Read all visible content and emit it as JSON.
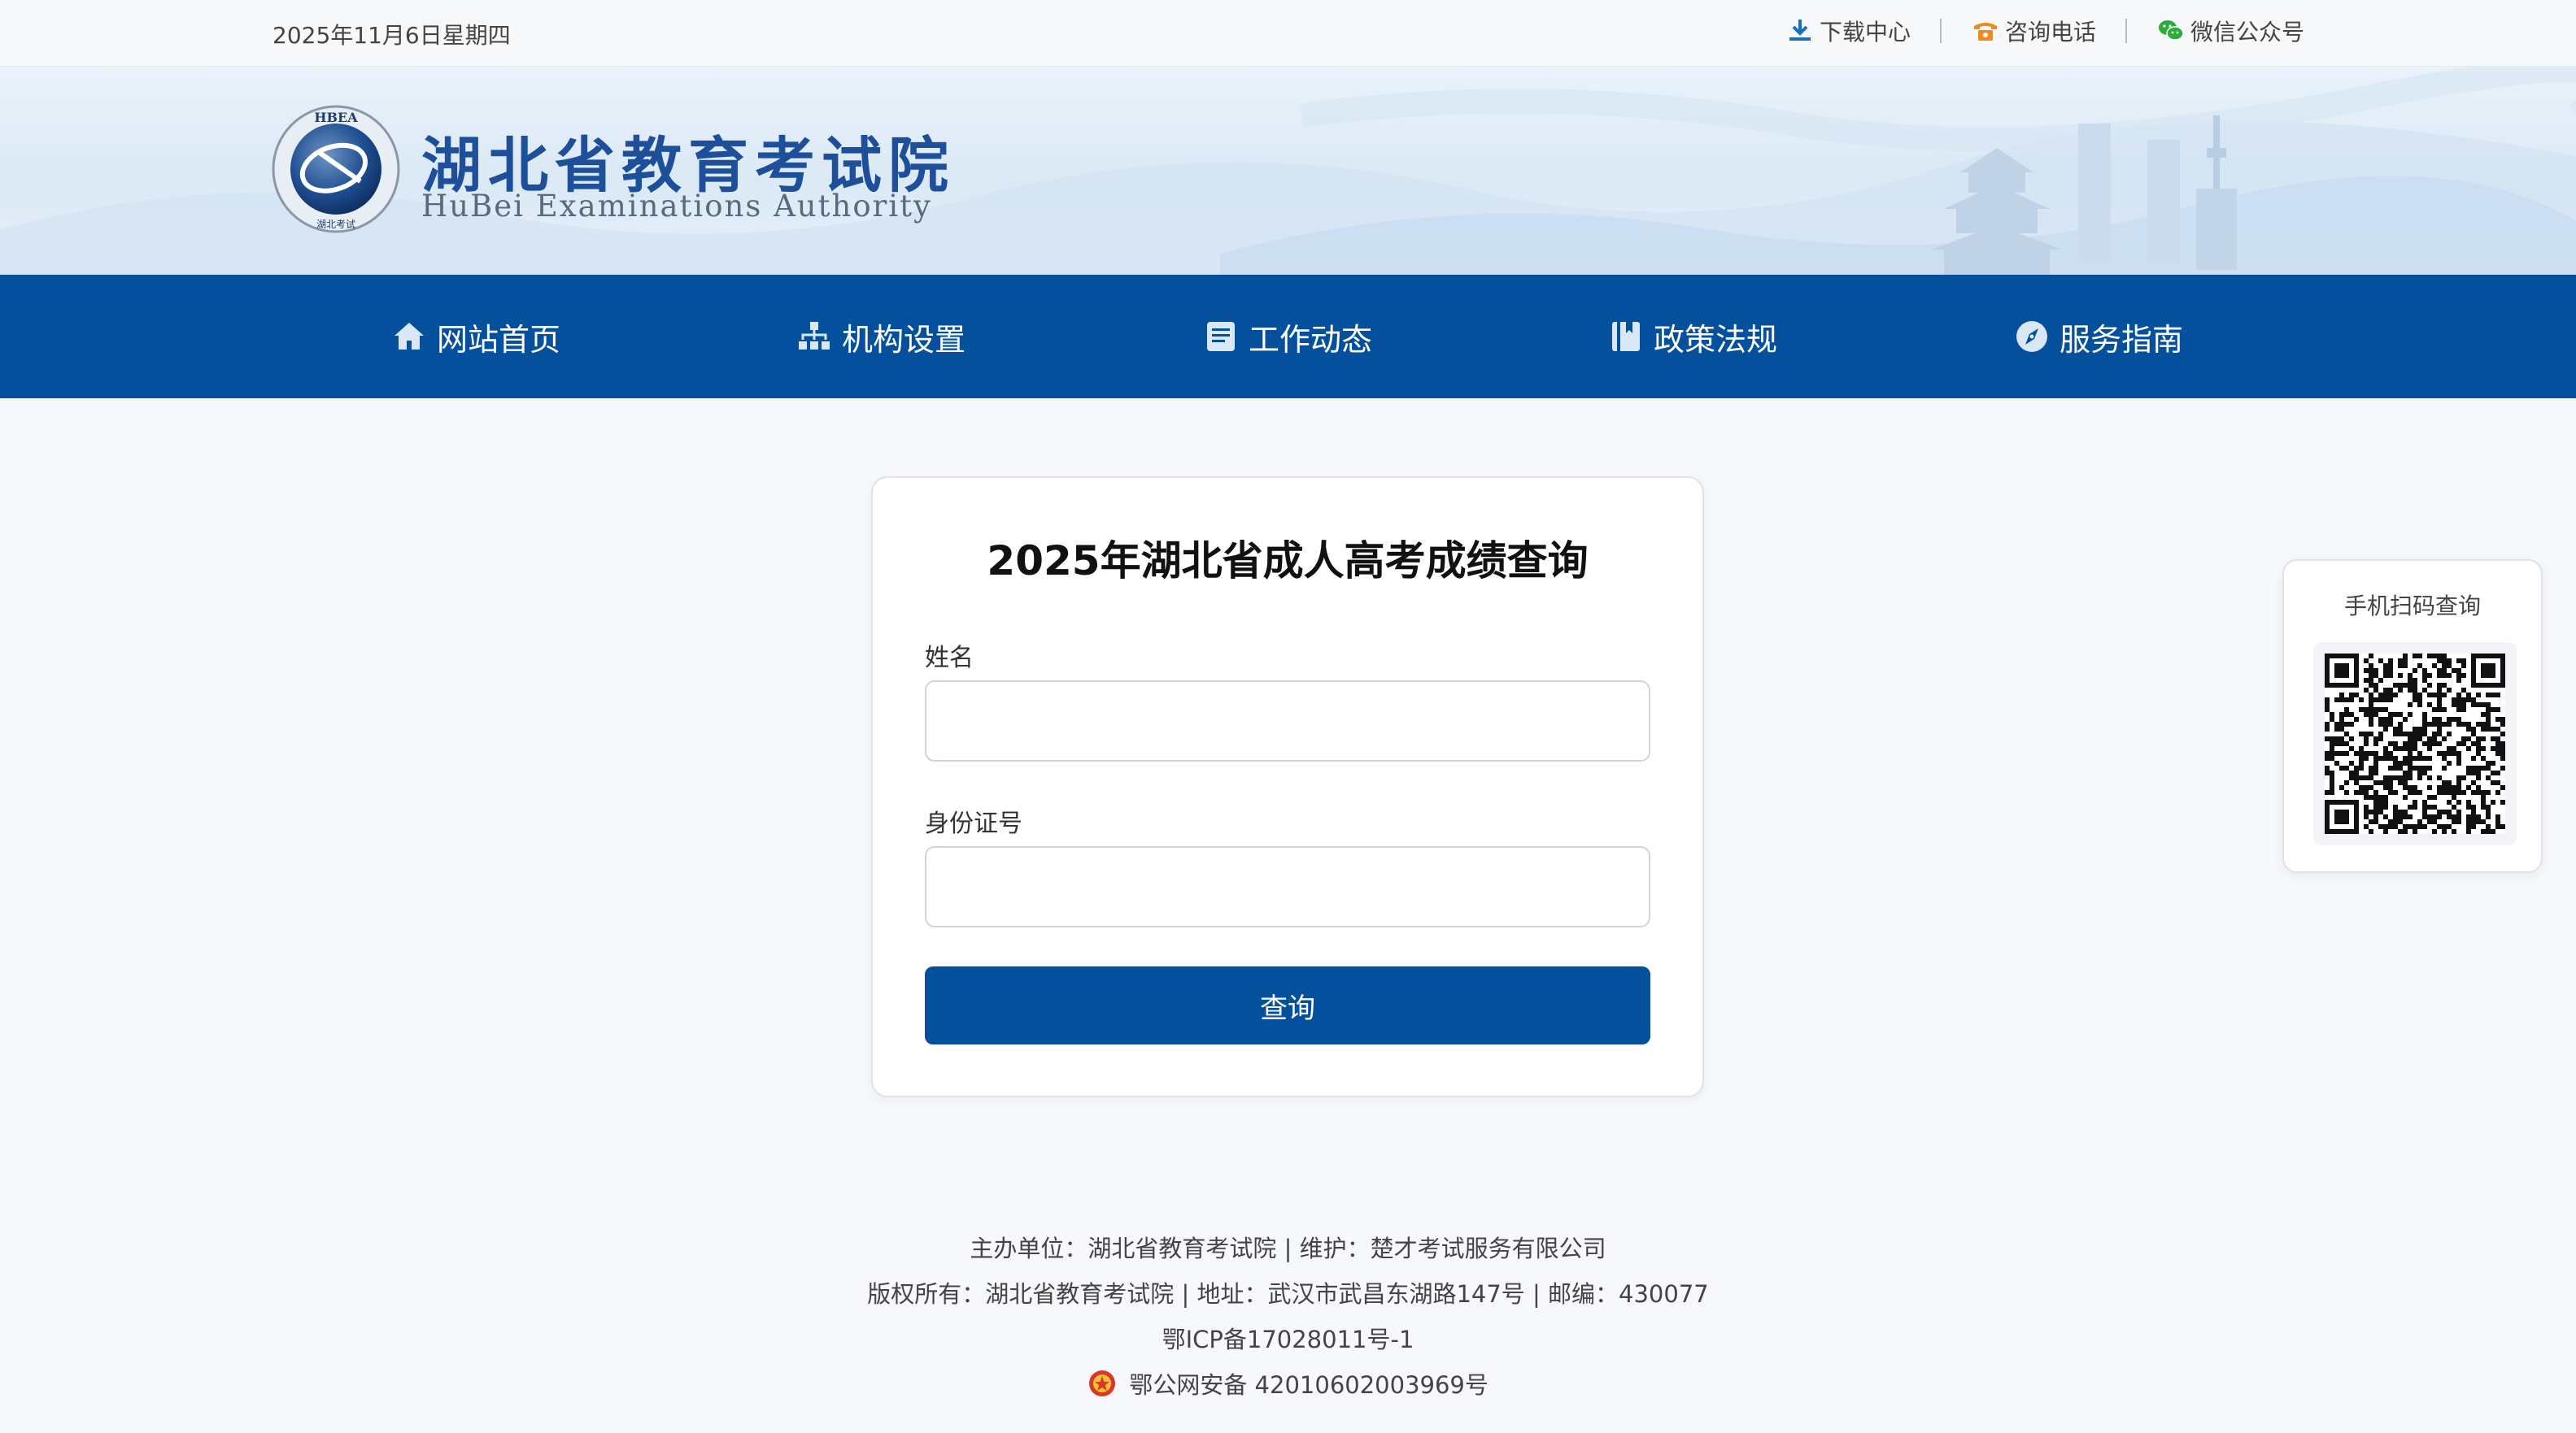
{
  "topbar": {
    "date": "2025年11月6日星期四",
    "links": [
      {
        "label": "下载中心",
        "icon": "download-icon",
        "color": "#1a6fc0"
      },
      {
        "label": "咨询电话",
        "icon": "phone-icon",
        "color": "#f08a1c"
      },
      {
        "label": "微信公众号",
        "icon": "wechat-icon",
        "color": "#2aae3a"
      }
    ]
  },
  "header": {
    "emblem_text": "HBEA",
    "emblem_bottom_text": "湖北考试",
    "title": "湖北省教育考试院",
    "subtitle": "HuBei Examinations Authority"
  },
  "nav": {
    "items": [
      {
        "label": "网站首页",
        "icon": "home-icon"
      },
      {
        "label": "机构设置",
        "icon": "org-chart-icon"
      },
      {
        "label": "工作动态",
        "icon": "news-icon"
      },
      {
        "label": "政策法规",
        "icon": "book-icon"
      },
      {
        "label": "服务指南",
        "icon": "compass-icon"
      }
    ]
  },
  "form": {
    "title": "2025年湖北省成人高考成绩查询",
    "name_label": "姓名",
    "name_value": "",
    "id_label": "身份证号",
    "id_value": "",
    "submit_label": "查询"
  },
  "qr": {
    "title": "手机扫码查询"
  },
  "footer": {
    "sponsor": "主办单位：湖北省教育考试院 | 维护：楚才考试服务有限公司",
    "copyright": "版权所有：湖北省教育考试院 | 地址：武汉市武昌东湖路147号 | 邮编：430077",
    "icp": "鄂ICP备17028011号-1",
    "police": "鄂公网安备 42010602003969号"
  },
  "colors": {
    "brand": "#04509c",
    "title_blue": "#1d4f9a"
  }
}
